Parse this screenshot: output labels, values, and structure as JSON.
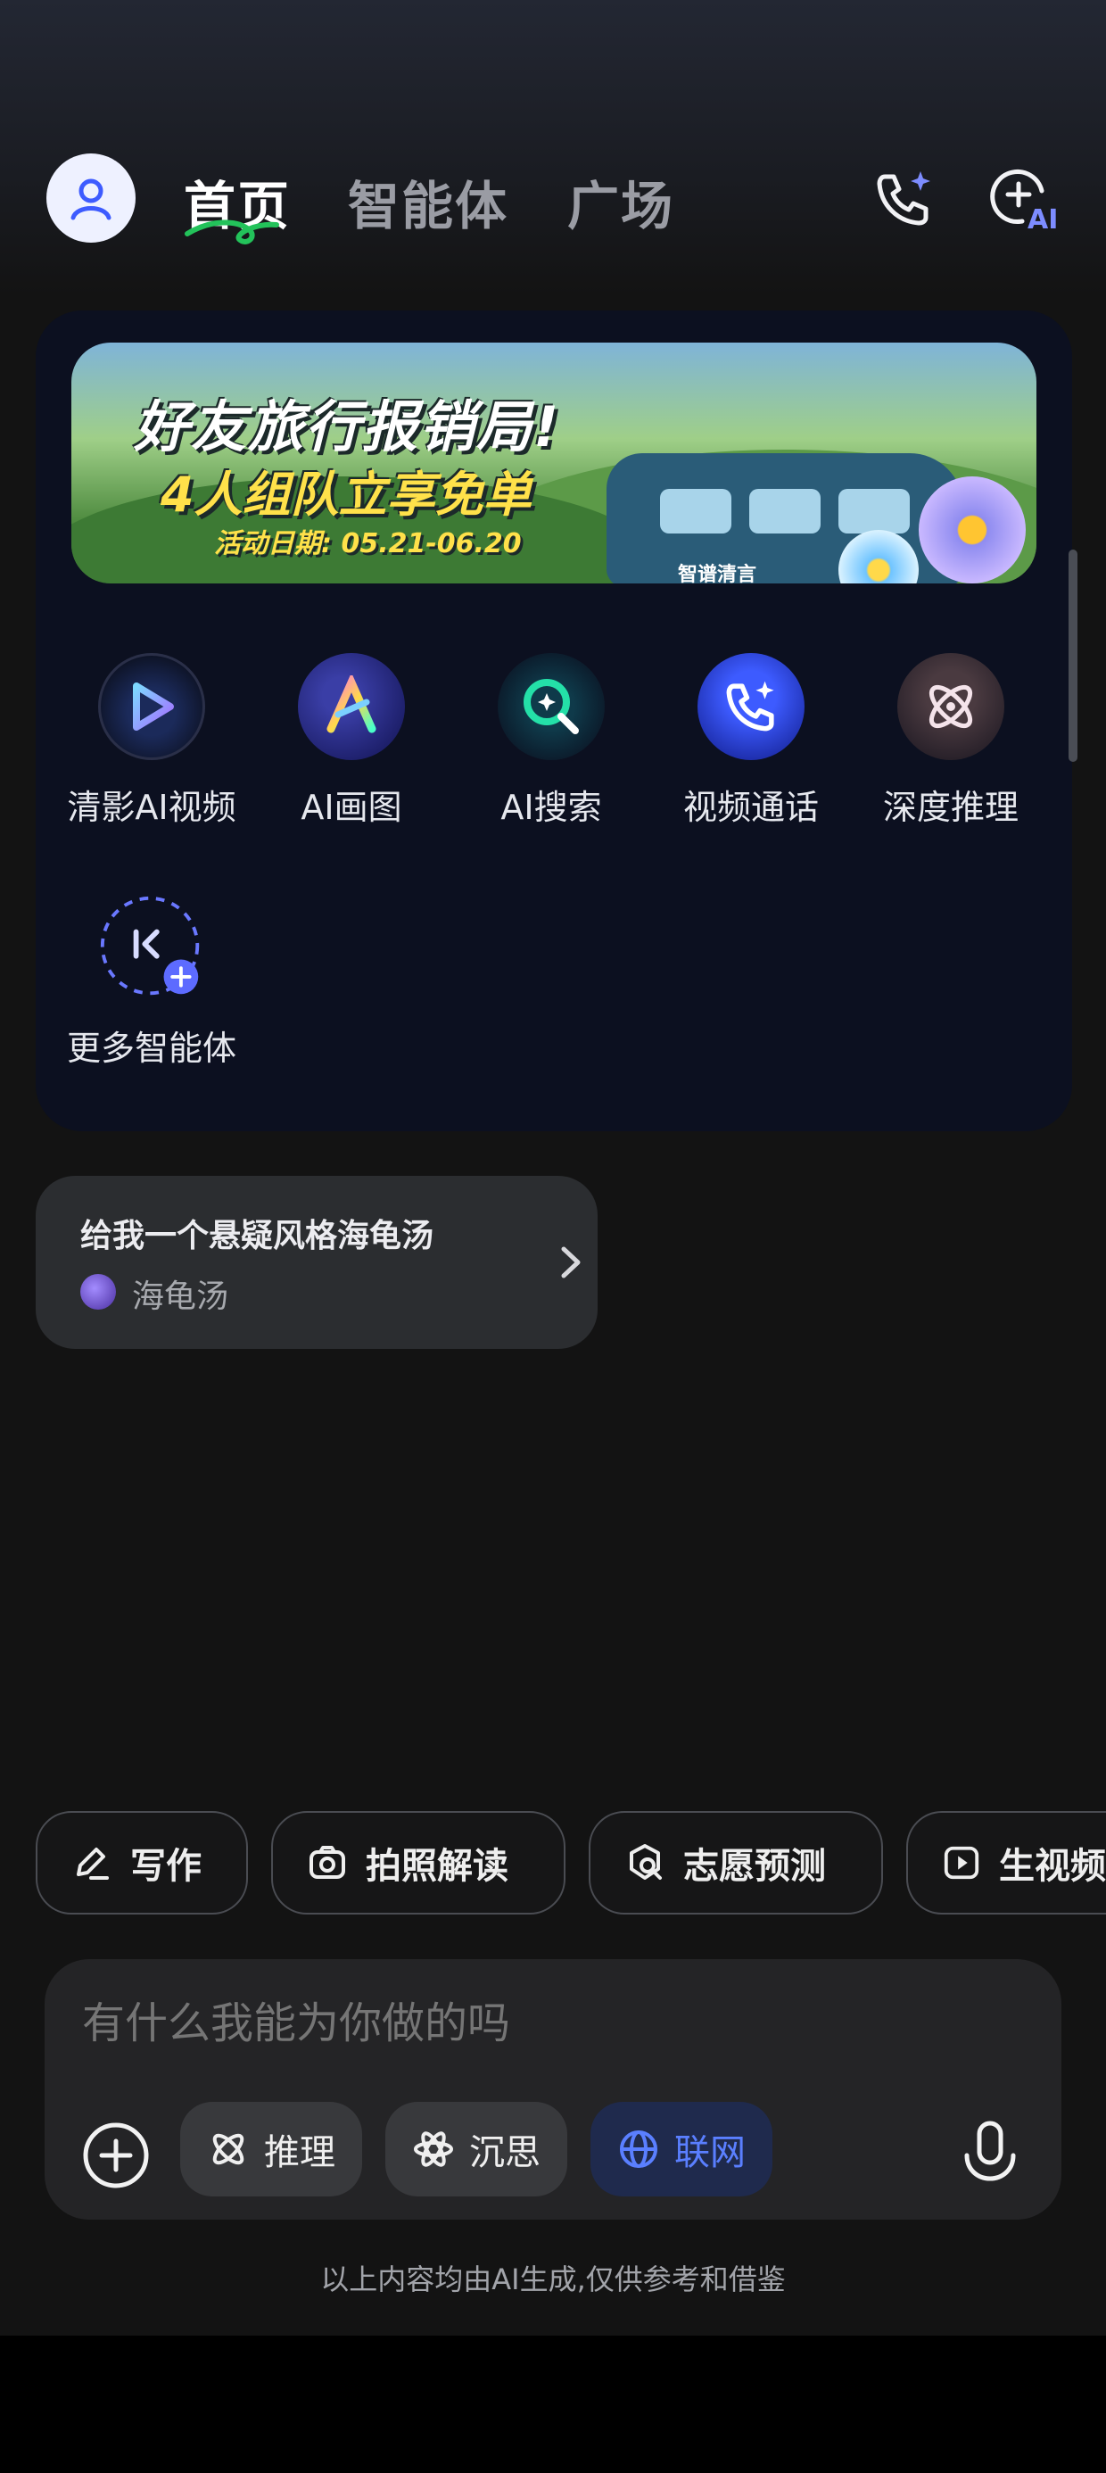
{
  "header": {
    "tabs": [
      {
        "label": "首页",
        "active": true
      },
      {
        "label": "智能体",
        "active": false
      },
      {
        "label": "广场",
        "active": false
      }
    ]
  },
  "banner": {
    "title": "好友旅行报销局!",
    "subtitle": "4人组队立享免单",
    "date": "活动日期: 05.21-06.20",
    "brand": "智谱清言"
  },
  "agents": [
    {
      "label": "清影AI视频",
      "icon": "play-video-icon"
    },
    {
      "label": "AI画图",
      "icon": "ai-paint-icon"
    },
    {
      "label": "AI搜索",
      "icon": "ai-search-icon"
    },
    {
      "label": "视频通话",
      "icon": "video-call-icon"
    },
    {
      "label": "深度推理",
      "icon": "atom-icon"
    },
    {
      "label": "更多智能体",
      "icon": "more-agents-icon"
    }
  ],
  "suggestion": {
    "question": "给我一个悬疑风格海龟汤",
    "source": "海龟汤"
  },
  "chips": [
    {
      "label": "写作",
      "icon": "pen-icon"
    },
    {
      "label": "拍照解读",
      "icon": "camera-icon"
    },
    {
      "label": "志愿预测",
      "icon": "forecast-icon"
    },
    {
      "label": "生视频",
      "icon": "video-play-icon"
    }
  ],
  "input": {
    "placeholder": "有什么我能为你做的吗",
    "tools": [
      {
        "label": "推理",
        "active": false
      },
      {
        "label": "沉思",
        "active": false
      },
      {
        "label": "联网",
        "active": true
      }
    ]
  },
  "disclaimer": "以上内容均由AI生成,仅供参考和借鉴",
  "colors": {
    "background": "#131313",
    "card": "#0c1020",
    "accent": "#5a7fff"
  }
}
